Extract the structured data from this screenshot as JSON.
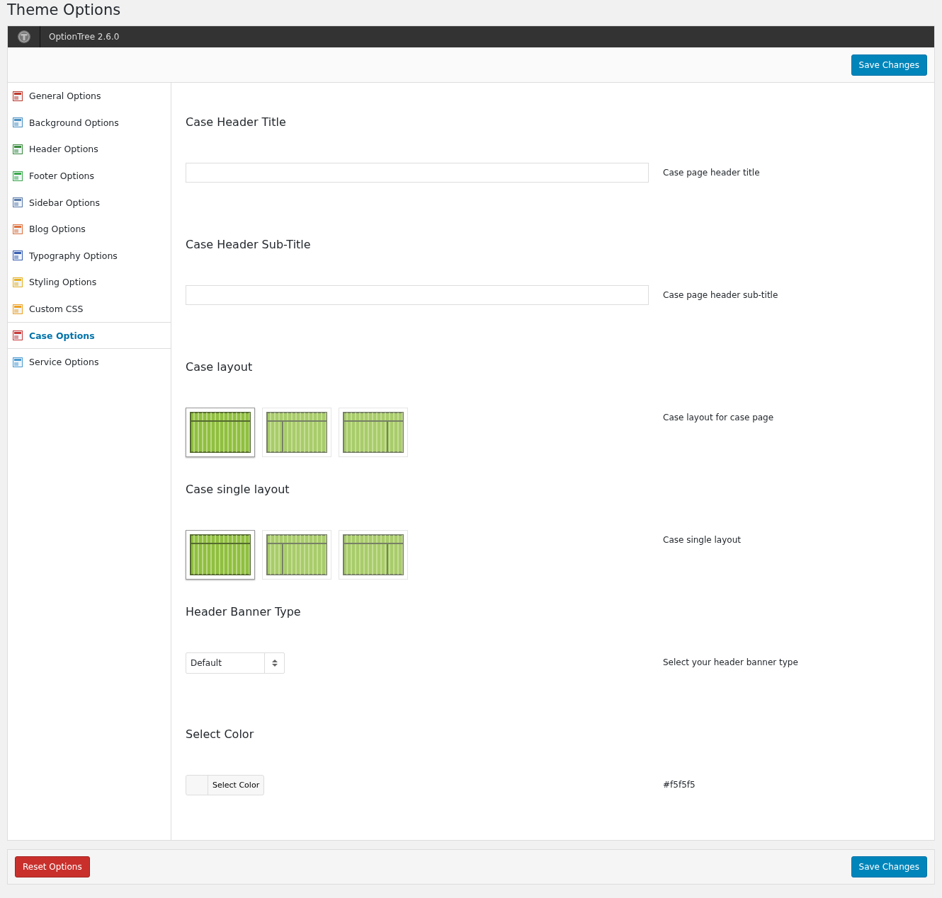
{
  "page_title": "Theme Options",
  "header": {
    "version": "OptionTree 2.6.0"
  },
  "save_button": "Save Changes",
  "sidebar": {
    "items": [
      {
        "label": "General Options",
        "selected": false
      },
      {
        "label": "Background Options",
        "selected": false
      },
      {
        "label": "Header Options",
        "selected": false
      },
      {
        "label": "Footer Options",
        "selected": false
      },
      {
        "label": "Sidebar Options",
        "selected": false
      },
      {
        "label": "Blog Options",
        "selected": false
      },
      {
        "label": "Typography Options",
        "selected": false
      },
      {
        "label": "Styling Options",
        "selected": false
      },
      {
        "label": "Custom CSS",
        "selected": false
      },
      {
        "label": "Case Options",
        "selected": true
      },
      {
        "label": "Service Options",
        "selected": false
      }
    ]
  },
  "settings": [
    {
      "kind": "text",
      "title": "Case Header Title",
      "description": "Case page header title"
    },
    {
      "kind": "text",
      "title": "Case Header Sub-Title",
      "description": "Case page header sub-title"
    },
    {
      "kind": "layout",
      "title": "Case layout",
      "description": "Case layout for case page",
      "options": [
        {
          "selected": true
        },
        {
          "selected": false
        },
        {
          "selected": false
        }
      ]
    },
    {
      "kind": "layout",
      "title": "Case single layout",
      "description": "Case single layout",
      "options": [
        {
          "selected": true
        },
        {
          "selected": false
        },
        {
          "selected": false
        }
      ]
    },
    {
      "kind": "select",
      "title": "Header Banner Type",
      "value": "Default",
      "description": "Select your header banner type"
    },
    {
      "kind": "color",
      "title": "Select Color",
      "button": "Select Color",
      "description": "#f5f5f5"
    }
  ],
  "footer": {
    "reset_button": "Reset Options",
    "save_button": "Save Changes"
  }
}
